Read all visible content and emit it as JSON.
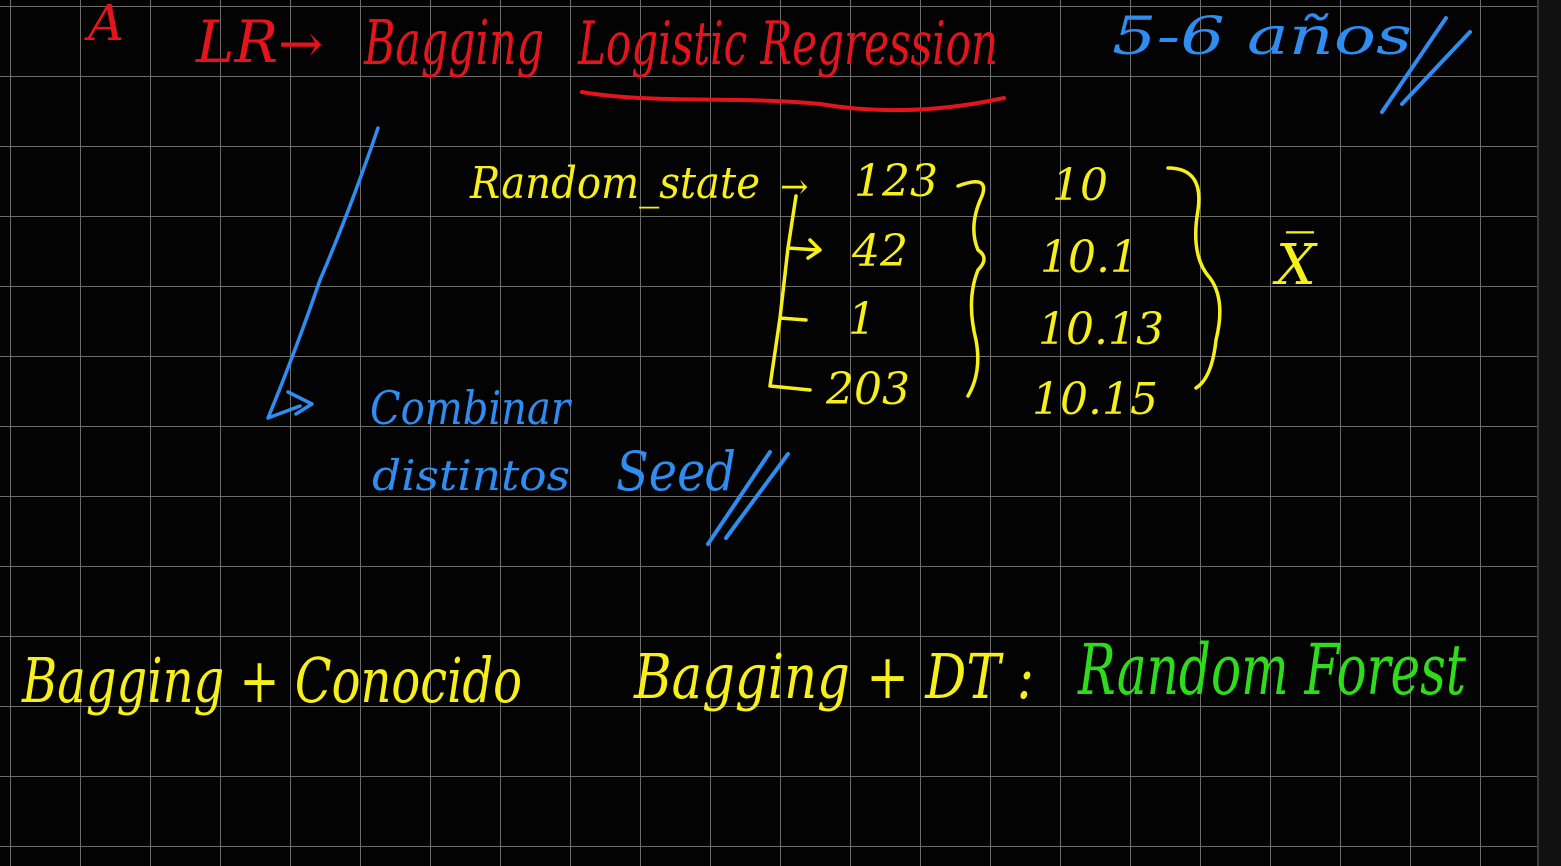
{
  "notes": {
    "header": {
      "marker": "A",
      "lr": "LR",
      "arrow": "→",
      "bagging": "Bagging",
      "logistic_regression": "Logistic Regression",
      "years": "5-6 años"
    },
    "seeds": {
      "label": "Random_state",
      "arrow": "→",
      "values": [
        "123",
        "42",
        "1",
        "203"
      ],
      "results": [
        "10",
        "10.1",
        "10.13",
        "10.15"
      ],
      "mean_symbol": "X̅"
    },
    "combine": {
      "line1": "Combinar",
      "line2": "distintos",
      "seed": "Seed"
    },
    "bottom": {
      "bagging_conocido": "Bagging + Conocido",
      "bagging_dt": "Bagging + DT :",
      "random_forest": "Random Forest"
    },
    "colors": {
      "background": "#030303",
      "grid": "#6c6c6c",
      "red": "#e3141c",
      "yellow": "#f7ef1c",
      "blue": "#2f8df2",
      "green": "#2fdc1c"
    }
  }
}
